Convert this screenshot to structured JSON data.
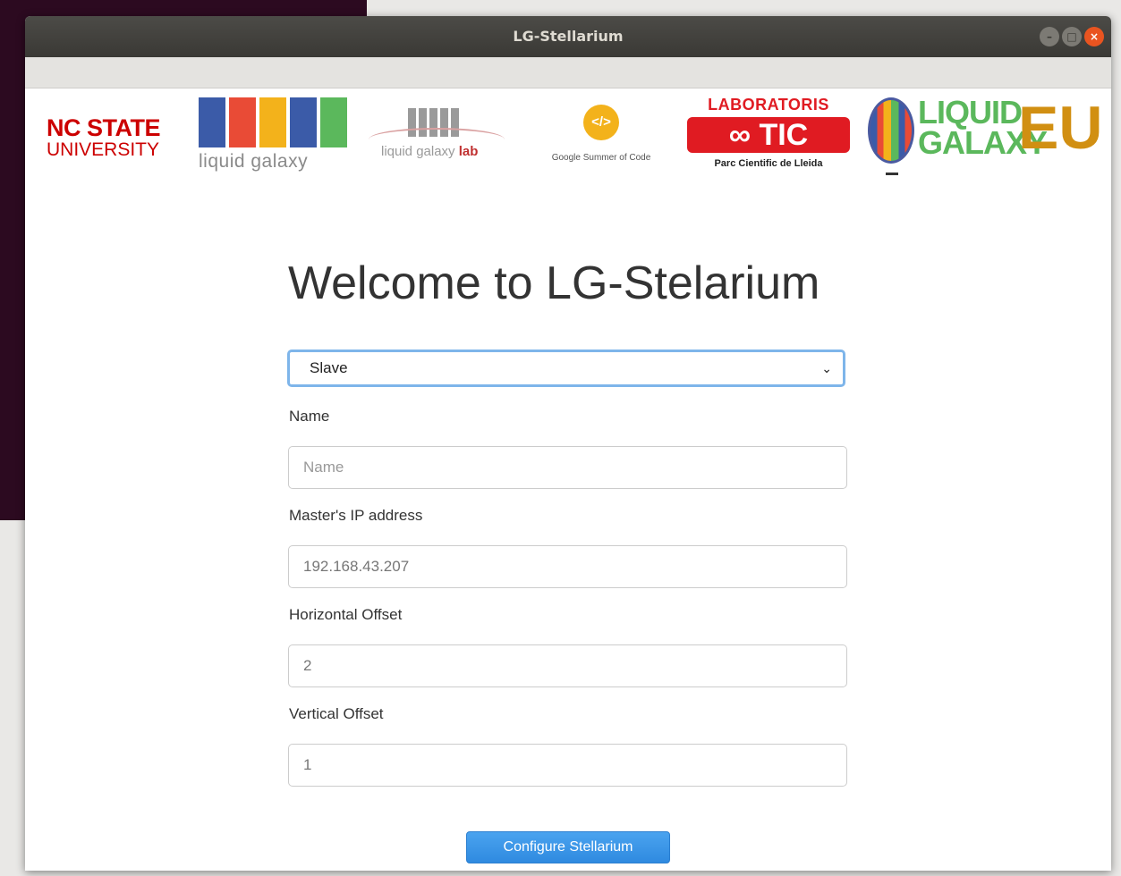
{
  "window": {
    "title": "LG-Stellarium"
  },
  "logos": {
    "ncstate_line1": "NC STATE",
    "ncstate_line2": "UNIVERSITY",
    "liquid_galaxy_text": "liquid galaxy",
    "lg_lab_text": "liquid galaxy",
    "lg_lab_bold": "lab",
    "gsoc_text": "Google Summer of Code",
    "tic_line1": "LABORATORIS",
    "tic_box": "TIC",
    "tic_line3": "Parc Cientific de Lleida",
    "lgeu_line1": "LIQUID",
    "lgeu_line2": "GALAXY",
    "lgeu_eu": "EU"
  },
  "form": {
    "heading": "Welcome to LG-Stelarium",
    "mode_select": "Slave",
    "name_label": "Name",
    "name_placeholder": "Name",
    "ip_label": "Master's IP address",
    "ip_value": "192.168.43.207",
    "hoffset_label": "Horizontal Offset",
    "hoffset_value": "2",
    "voffset_label": "Vertical Offset",
    "voffset_value": "1",
    "submit": "Configure Stellarium"
  },
  "colors": {
    "accent": "#2f8ae0",
    "titlebar": "#3a3935",
    "close": "#e95420"
  }
}
